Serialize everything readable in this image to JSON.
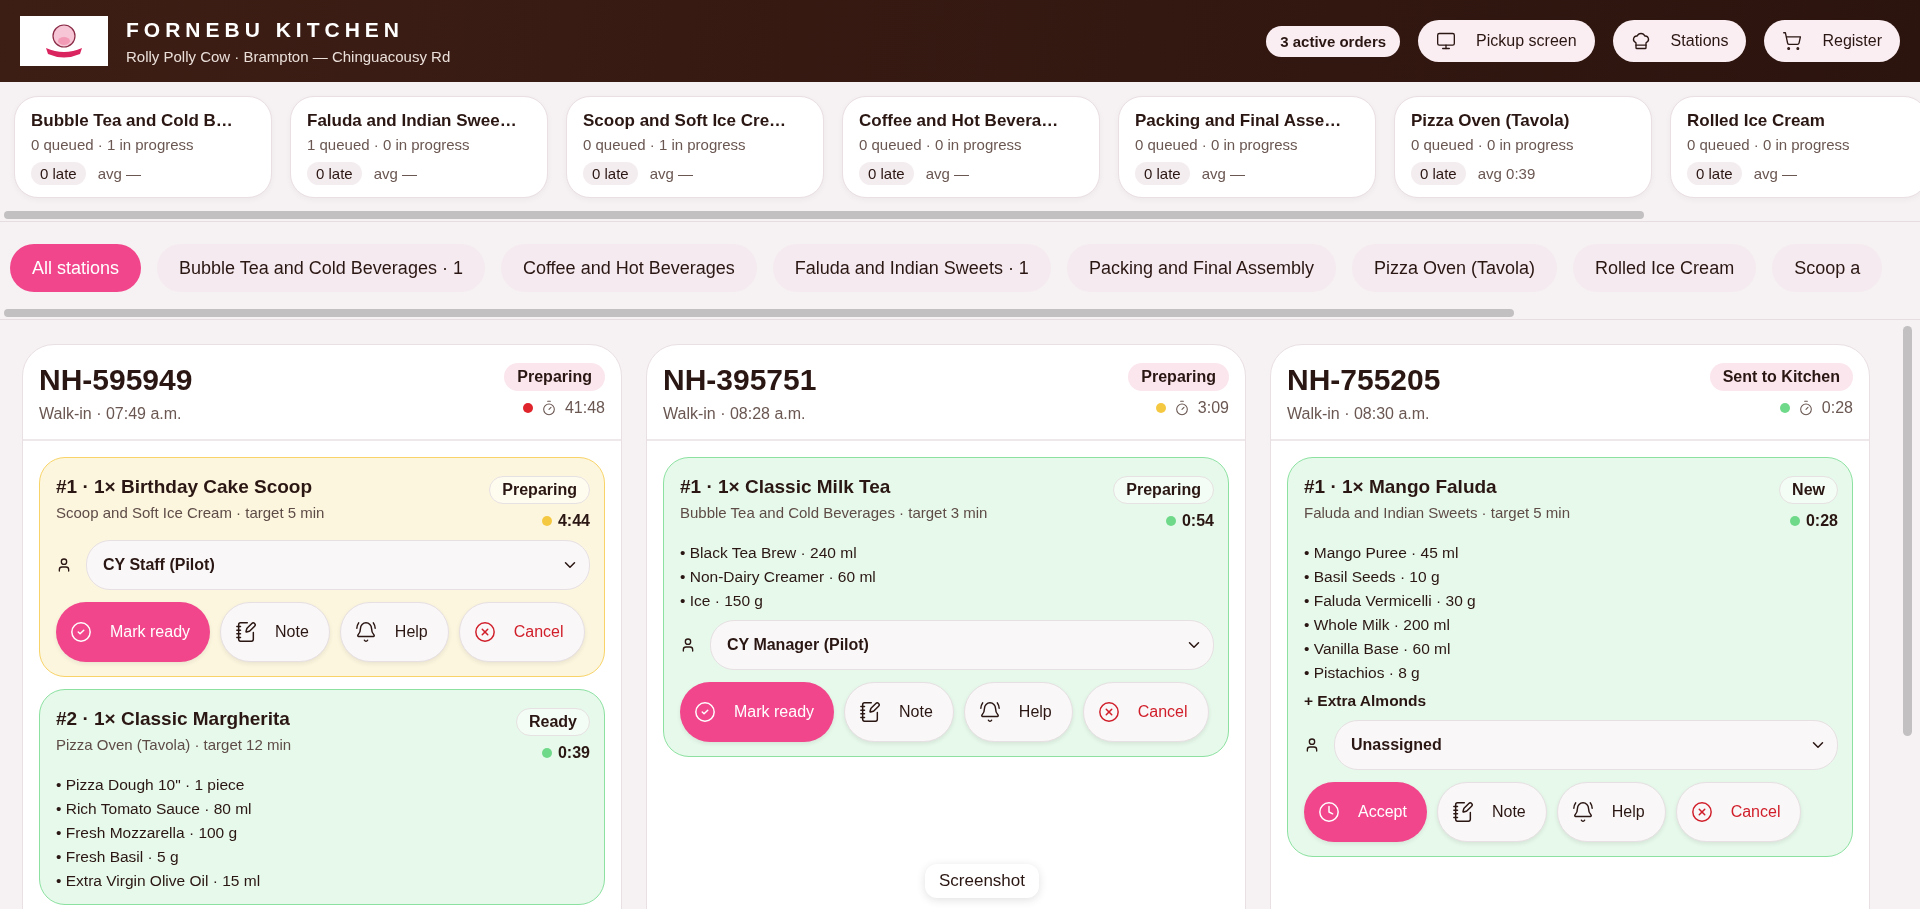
{
  "header": {
    "title": "FORNEBU KITCHEN",
    "subtitle": "Rolly Polly Cow · Brampton — Chinguacousy Rd",
    "active_orders": "3 active orders",
    "buttons": [
      {
        "label": "Pickup screen",
        "kind": "pickup"
      },
      {
        "label": "Stations",
        "kind": "stations"
      },
      {
        "label": "Register",
        "kind": "register"
      }
    ]
  },
  "station_cards": [
    {
      "name": "Bubble Tea and Cold B…",
      "counts": "0 queued · 1 in progress",
      "late": "0 late",
      "avg": "avg —"
    },
    {
      "name": "Faluda and Indian Swee…",
      "counts": "1 queued · 0 in progress",
      "late": "0 late",
      "avg": "avg —"
    },
    {
      "name": "Scoop and Soft Ice Cre…",
      "counts": "0 queued · 1 in progress",
      "late": "0 late",
      "avg": "avg —"
    },
    {
      "name": "Coffee and Hot Bevera…",
      "counts": "0 queued · 0 in progress",
      "late": "0 late",
      "avg": "avg —"
    },
    {
      "name": "Packing and Final Asse…",
      "counts": "0 queued · 0 in progress",
      "late": "0 late",
      "avg": "avg —"
    },
    {
      "name": "Pizza Oven (Tavola)",
      "counts": "0 queued · 0 in progress",
      "late": "0 late",
      "avg": "avg 0:39"
    },
    {
      "name": "Rolled Ice Cream",
      "counts": "0 queued · 0 in progress",
      "late": "0 late",
      "avg": "avg —"
    }
  ],
  "station_filters": [
    {
      "label": "All stations",
      "selected": true
    },
    {
      "label": "Bubble Tea and Cold Beverages · 1",
      "selected": false
    },
    {
      "label": "Coffee and Hot Beverages",
      "selected": false
    },
    {
      "label": "Faluda and Indian Sweets · 1",
      "selected": false
    },
    {
      "label": "Packing and Final Assembly",
      "selected": false
    },
    {
      "label": "Pizza Oven (Tavola)",
      "selected": false
    },
    {
      "label": "Rolled Ice Cream",
      "selected": false
    },
    {
      "label": "Scoop a",
      "selected": false
    }
  ],
  "orders": [
    {
      "id": "NH-595949",
      "meta": "Walk-in · 07:49 a.m.",
      "status": "Preparing",
      "timer": "41:48",
      "color": "#e0242b",
      "items": [
        {
          "title": "#1 · 1× Birthday Cake Scoop",
          "station": "Scoop and Soft Ice Cream · target 5 min",
          "status": "Preparing",
          "timer": "4:44",
          "color": "#f5c842",
          "assignee": "CY Staff (Pilot)",
          "actions": [
            {
              "label": "Mark ready",
              "kind": "ready"
            },
            {
              "label": "Note",
              "kind": "note"
            },
            {
              "label": "Help",
              "kind": "help"
            },
            {
              "label": "Cancel",
              "kind": "cancel"
            }
          ]
        },
        {
          "title": "#2 · 1× Classic Margherita",
          "station": "Pizza Oven (Tavola) · target 12 min",
          "status": "Ready",
          "timer": "0:39",
          "color": "#6fd98a",
          "ingredients": [
            "• Pizza Dough 10\" · 1 piece",
            "• Rich Tomato Sauce · 80 ml",
            "• Fresh Mozzarella · 100 g",
            "• Fresh Basil · 5 g",
            "• Extra Virgin Olive Oil · 15 ml"
          ]
        }
      ]
    },
    {
      "id": "NH-395751",
      "meta": "Walk-in · 08:28 a.m.",
      "status": "Preparing",
      "timer": "3:09",
      "color": "#f5c842",
      "items": [
        {
          "title": "#1 · 1× Classic Milk Tea",
          "station": "Bubble Tea and Cold Beverages · target 3 min",
          "status": "Preparing",
          "timer": "0:54",
          "color": "#6fd98a",
          "ingredients": [
            "• Black Tea Brew · 240 ml",
            "• Non-Dairy Creamer · 60 ml",
            "• Ice · 150 g"
          ],
          "assignee": "CY Manager (Pilot)",
          "actions": [
            {
              "label": "Mark ready",
              "kind": "ready"
            },
            {
              "label": "Note",
              "kind": "note"
            },
            {
              "label": "Help",
              "kind": "help"
            },
            {
              "label": "Cancel",
              "kind": "cancel"
            }
          ]
        }
      ]
    },
    {
      "id": "NH-755205",
      "meta": "Walk-in · 08:30 a.m.",
      "status": "Sent to Kitchen",
      "timer": "0:28",
      "color": "#6fd98a",
      "items": [
        {
          "title": "#1 · 1× Mango Faluda",
          "station": "Faluda and Indian Sweets · target 5 min",
          "status": "New",
          "timer": "0:28",
          "color": "#6fd98a",
          "ingredients": [
            "• Mango Puree · 45 ml",
            "• Basil Seeds · 10 g",
            "• Faluda Vermicelli · 30 g",
            "• Whole Milk · 200 ml",
            "• Vanilla Base · 60 ml",
            "• Pistachios · 8 g"
          ],
          "extra": "+ Extra Almonds",
          "assignee": "Unassigned",
          "actions": [
            {
              "label": "Accept",
              "kind": "accept"
            },
            {
              "label": "Note",
              "kind": "note"
            },
            {
              "label": "Help",
              "kind": "help"
            },
            {
              "label": "Cancel",
              "kind": "cancel"
            }
          ]
        }
      ]
    }
  ],
  "tooltip": "Screenshot"
}
